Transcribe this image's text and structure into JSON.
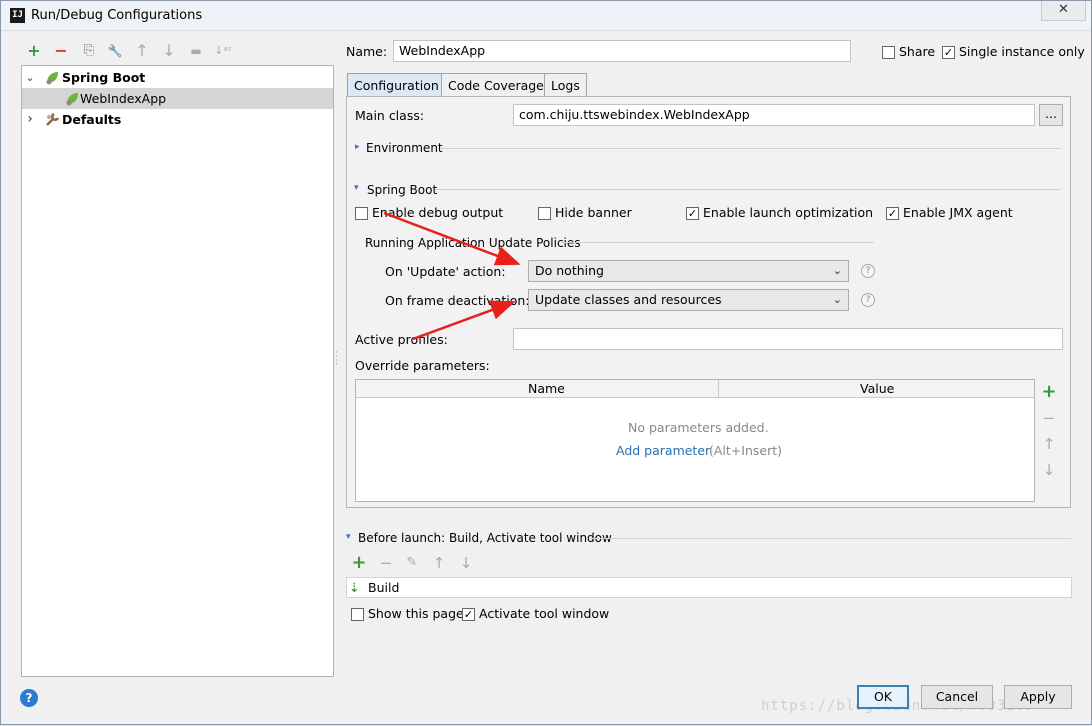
{
  "window": {
    "title": "Run/Debug Configurations",
    "close_icon": "✕",
    "app_icon_text": "IJ"
  },
  "left_toolbar": {
    "add": "+",
    "remove": "−",
    "copy": "⎘",
    "edit": "🔧",
    "up": "↑",
    "down": "↓",
    "folder": "▬",
    "sort": "↓ᵃᶻ"
  },
  "tree": {
    "spring_boot": {
      "label": "Spring Boot",
      "expander": "⌄"
    },
    "web_index_app": {
      "label": "WebIndexApp"
    },
    "defaults": {
      "label": "Defaults",
      "expander": "›"
    }
  },
  "header": {
    "name_label": "Name:",
    "name_value": "WebIndexApp",
    "share_label": "Share",
    "share_checked": "",
    "single_instance_label": "Single instance only",
    "single_instance_checked": "✓"
  },
  "tabs": {
    "configuration": "Configuration",
    "code_coverage": "Code Coverage",
    "logs": "Logs"
  },
  "config": {
    "main_class_label": "Main class:",
    "main_class_value": "com.chiju.ttswebindex.WebIndexApp",
    "browse_label": "...",
    "environment_label": "Environment",
    "environment_arrow": "▸",
    "spring_boot_label": "Spring Boot",
    "spring_boot_arrow": "▾",
    "enable_debug_label": "Enable debug output",
    "enable_debug_checked": "",
    "hide_banner_label": "Hide banner",
    "hide_banner_checked": "",
    "launch_opt_label": "Enable launch optimization",
    "launch_opt_checked": "✓",
    "jmx_label": "Enable JMX agent",
    "jmx_checked": "✓",
    "policies_label": "Running Application Update Policies",
    "on_update_label": "On 'Update' action:",
    "on_update_value": "Do nothing",
    "on_frame_label": "On frame deactivation:",
    "on_frame_value": "Update classes and resources",
    "select_chevron": "⌄",
    "help_icon": "?",
    "active_profiles_label": "Active profiles:",
    "active_profiles_value": "",
    "override_label": "Override parameters:",
    "table": {
      "col_name": "Name",
      "col_value": "Value",
      "empty_text": "No parameters added.",
      "add_link": "Add parameter",
      "add_hint": "(Alt+Insert)"
    },
    "table_tools": {
      "add": "+",
      "remove": "−",
      "up": "↑",
      "down": "↓"
    }
  },
  "before_launch": {
    "label": "Before launch: Build, Activate tool window",
    "arrow": "▾",
    "tools": {
      "add": "+",
      "remove": "−",
      "edit": "✎",
      "up": "↑",
      "down": "↓"
    },
    "build_label": "Build",
    "build_icon_glyph": "⇣",
    "show_page_label": "Show this page",
    "show_page_checked": "",
    "activate_label": "Activate tool window",
    "activate_checked": "✓"
  },
  "buttons": {
    "ok": "OK",
    "cancel": "Cancel",
    "apply": "Apply",
    "help": "?"
  },
  "watermark": "https://blog.csdn.net/w903109"
}
